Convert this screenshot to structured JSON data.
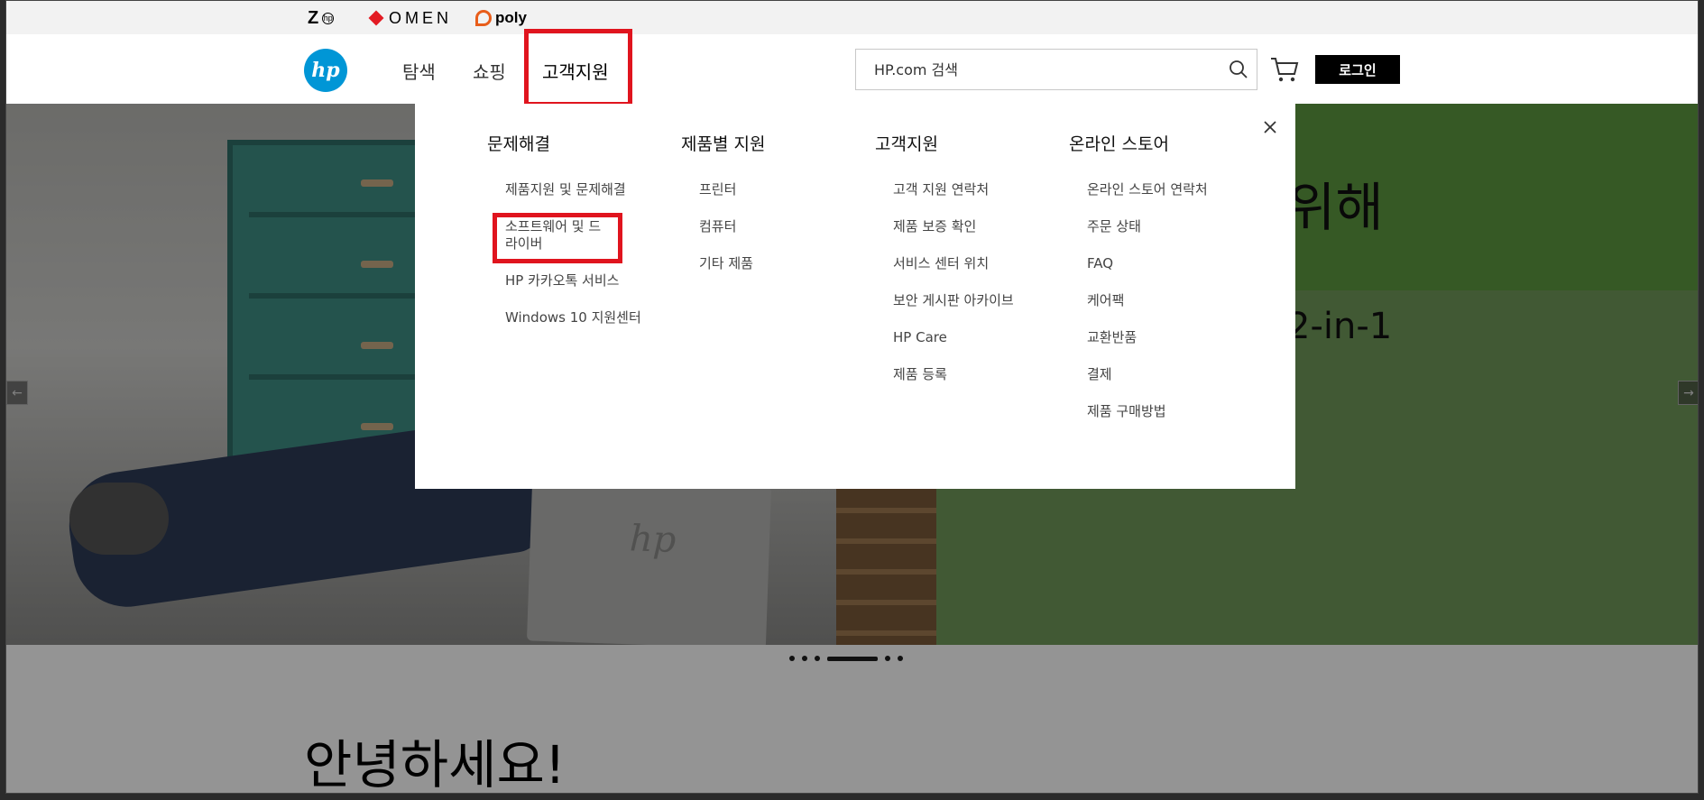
{
  "brands": {
    "z": "Z",
    "z_badge": "hp",
    "omen": "OMEN",
    "poly": "poly"
  },
  "header": {
    "logo": "hp",
    "nav": [
      "탐색",
      "쇼핑",
      "고객지원"
    ],
    "search_placeholder": "HP.com 검색",
    "login": "로그인"
  },
  "hero": {
    "title": "위해",
    "subtitle": "2-in-1",
    "laptop_logo": "hp",
    "arrow_left": "←",
    "arrow_right": "→"
  },
  "greeting": "안녕하세요!",
  "mega_menu": {
    "columns": [
      {
        "heading": "문제해결",
        "links": [
          "제품지원 및 문제해결",
          "소프트웨어 및 드라이버",
          "HP 카카오톡 서비스",
          "Windows 10 지원센터"
        ]
      },
      {
        "heading": "제품별 지원",
        "links": [
          "프린터",
          "컴퓨터",
          "기타 제품"
        ]
      },
      {
        "heading": "고객지원",
        "links": [
          "고객 지원 연락처",
          "제품 보증 확인",
          "서비스 센터 위치",
          "보안 게시판 아카이브",
          "HP Care",
          "제품 등록"
        ]
      },
      {
        "heading": "온라인 스토어",
        "links": [
          "온라인 스토어 연락처",
          "주문 상태",
          "FAQ",
          "케어팩",
          "교환반품",
          "결제",
          "제품 구매방법"
        ]
      }
    ]
  },
  "colors": {
    "hp_blue": "#0096d6",
    "highlight_red": "#e0141e",
    "hero_green": "#5e9a40"
  },
  "icons": [
    "search-icon",
    "cart-icon",
    "close-icon",
    "arrow-left-icon",
    "arrow-right-icon"
  ]
}
